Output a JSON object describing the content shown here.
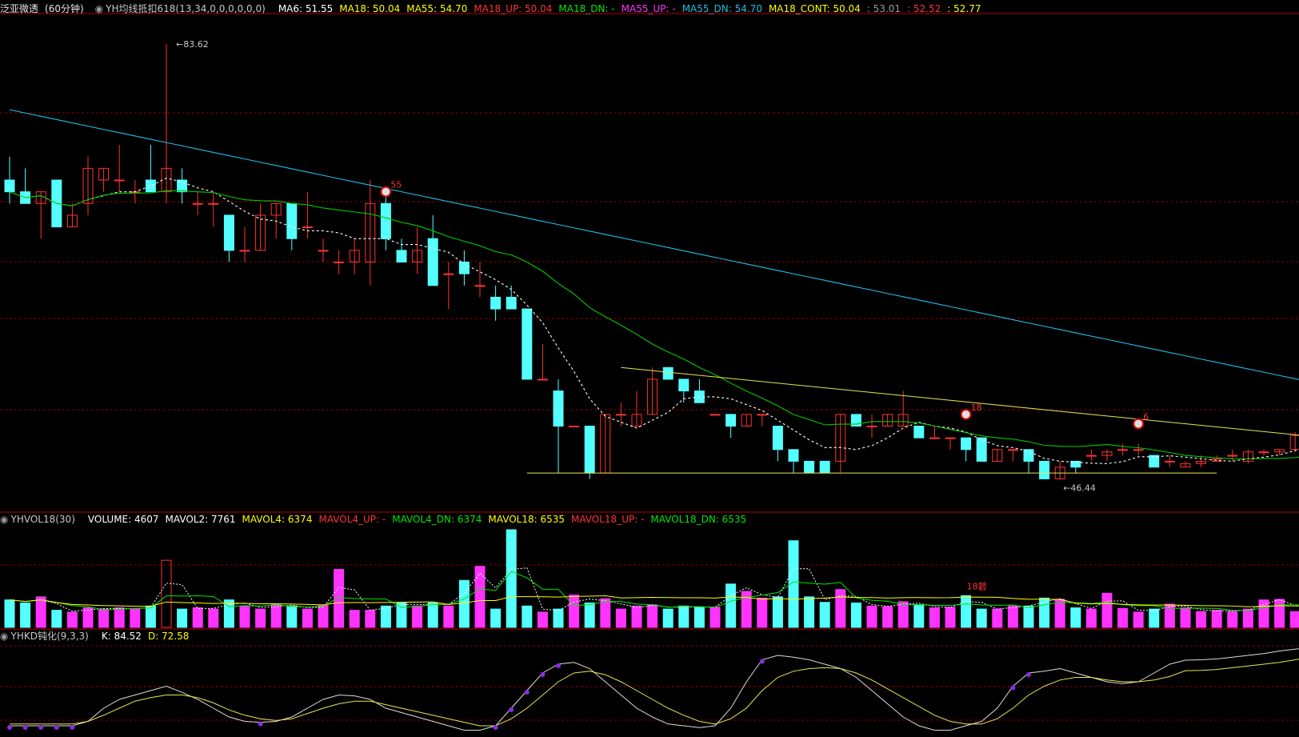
{
  "main_header": {
    "stock": "泛亚微透",
    "period": "(60分钟)",
    "indicator": "YH均线抵扣618(13,34,0,0,0,0,0,0)",
    "ma6": "MA6: 51.55",
    "ma18": "MA18: 50.04",
    "ma55": "MA55: 54.70",
    "ma18_up": "MA18_UP: 50.04",
    "ma18_dn": "MA18_DN: -",
    "ma55_up": "MA55_UP: -",
    "ma55_dn": "MA55_DN: 54.70",
    "ma18_cont": "MA18_CONT: 50.04",
    "v1": ": 53.01",
    "v2": ": 52.52",
    "v3": ": 52.77"
  },
  "vol_header": {
    "indicator": "YHVOL18(30)",
    "volume": "VOLUME: 4607",
    "mavol2": "MAVOL2: 7761",
    "mavol4": "MAVOL4: 6374",
    "mavol4_up": "MAVOL4_UP: -",
    "mavol4_dn": "MAVOL4_DN: 6374",
    "mavol18": "MAVOL18: 6535",
    "mavol18_up": "MAVOL18_UP: -",
    "mavol18_dn": "MAVOL18_DN: 6535"
  },
  "kd_header": {
    "indicator": "YHKD钝化(9,3,3)",
    "k": "K: 84.52",
    "d": "D: 72.58"
  },
  "annotations": {
    "high": "83.62",
    "low": "46.44",
    "mark1": "55",
    "mark2": "18",
    "mark3": "6",
    "vol_mark": "18碧"
  },
  "colors": {
    "up": "#ff3232",
    "down": "#54ffff",
    "ma6": "#ffffff",
    "ma18": "#00c800",
    "ma55": "#1ebde6",
    "trend": "#e6e650",
    "vol_up": "#ff32ff",
    "grid": "#8b0000"
  },
  "chart_data": {
    "type": "candlestick",
    "price_axis": [
      46.44,
      83.62
    ],
    "candles": [
      [
        72,
        74,
        70,
        71
      ],
      [
        71,
        73,
        70,
        70
      ],
      [
        70,
        71,
        67,
        71
      ],
      [
        72,
        72,
        68,
        68
      ],
      [
        68,
        70,
        68,
        69
      ],
      [
        70,
        74,
        69,
        73
      ],
      [
        72,
        73,
        71,
        73
      ],
      [
        72,
        75,
        71,
        72
      ],
      [
        71,
        72,
        70,
        71
      ],
      [
        72,
        75,
        71,
        71
      ],
      [
        71,
        83.62,
        70,
        73
      ],
      [
        72,
        73,
        70,
        71
      ],
      [
        70,
        71,
        69,
        70
      ],
      [
        70,
        71,
        68,
        70
      ],
      [
        69,
        69,
        65,
        66
      ],
      [
        66,
        68,
        65,
        66
      ],
      [
        66,
        70,
        66,
        69
      ],
      [
        69,
        70,
        67,
        70
      ],
      [
        70,
        70,
        66,
        67
      ],
      [
        68,
        71,
        67,
        68
      ],
      [
        66,
        67,
        65,
        66
      ],
      [
        65,
        66,
        64,
        65
      ],
      [
        65,
        67,
        64,
        66
      ],
      [
        65,
        72,
        63,
        70
      ],
      [
        70,
        71,
        66,
        67
      ],
      [
        66,
        67,
        65,
        65
      ],
      [
        65,
        68,
        64,
        66
      ],
      [
        67,
        69,
        63,
        63
      ],
      [
        64,
        65,
        61,
        64
      ],
      [
        65,
        66,
        63,
        64
      ],
      [
        63,
        65,
        62,
        63
      ],
      [
        62,
        63,
        60,
        61
      ],
      [
        62,
        63,
        61,
        61
      ],
      [
        61,
        61,
        55,
        55
      ],
      [
        55,
        58,
        55,
        55
      ],
      [
        54,
        55,
        47,
        51
      ],
      [
        51,
        51,
        51,
        51
      ],
      [
        51,
        51,
        46.5,
        47
      ],
      [
        47,
        52,
        47,
        52
      ],
      [
        52,
        53,
        51,
        52
      ],
      [
        51,
        54,
        51,
        52
      ],
      [
        52,
        56,
        52,
        55
      ],
      [
        56,
        56,
        55,
        55
      ],
      [
        55,
        55,
        53,
        54
      ],
      [
        54,
        55,
        53,
        53
      ],
      [
        52,
        52,
        52,
        52
      ],
      [
        52,
        52,
        50,
        51
      ],
      [
        51,
        52,
        51,
        52
      ],
      [
        52,
        52,
        51,
        52
      ],
      [
        51,
        51,
        48,
        49
      ],
      [
        49,
        49,
        47,
        48
      ],
      [
        48,
        48,
        47,
        47
      ],
      [
        48,
        48,
        47,
        47
      ],
      [
        48,
        52,
        47,
        52
      ],
      [
        52,
        52,
        51,
        51
      ],
      [
        51,
        52,
        50,
        51
      ],
      [
        51,
        52,
        51,
        52
      ],
      [
        51,
        54,
        51,
        52
      ],
      [
        51,
        51,
        50,
        50
      ],
      [
        50,
        51,
        50,
        50
      ],
      [
        50,
        50,
        49,
        50
      ],
      [
        50,
        50,
        48,
        49
      ],
      [
        50,
        50,
        48,
        48
      ],
      [
        48,
        49,
        48,
        49
      ],
      [
        49,
        49,
        48,
        49
      ],
      [
        49,
        49,
        47,
        48
      ],
      [
        48,
        48,
        46.5,
        46.5
      ],
      [
        46.5,
        48,
        46.44,
        47.5
      ],
      [
        48,
        48,
        47,
        47.5
      ],
      [
        48.5,
        49,
        48,
        48.5
      ],
      [
        48.5,
        49,
        48,
        48.8
      ],
      [
        49,
        49.5,
        48.5,
        49
      ],
      [
        49,
        49.5,
        48.5,
        49
      ],
      [
        48.5,
        48.5,
        47.5,
        47.5
      ],
      [
        48,
        48.5,
        47.5,
        48
      ],
      [
        47.5,
        48,
        47.5,
        47.8
      ],
      [
        47.8,
        48.5,
        47.5,
        48
      ],
      [
        48,
        48.5,
        48,
        48.2
      ],
      [
        48.5,
        49,
        48,
        48.5
      ],
      [
        48,
        49,
        47.8,
        48.8
      ],
      [
        48.8,
        49,
        48.5,
        48.8
      ],
      [
        48.8,
        49,
        48.5,
        49
      ],
      [
        49,
        50.5,
        48.8,
        50.2
      ],
      [
        50.5,
        51.5,
        50.2,
        51.3
      ],
      [
        50.5,
        52.52,
        50.5,
        52.52
      ]
    ],
    "volume_axis": [
      0,
      16000
    ],
    "volume": [
      4500,
      4000,
      5000,
      2800,
      2500,
      3200,
      3000,
      3200,
      3000,
      3500,
      11000,
      3000,
      3200,
      3000,
      4500,
      3500,
      3000,
      3800,
      3500,
      3000,
      3600,
      9500,
      2800,
      2800,
      3500,
      4000,
      3500,
      4000,
      3500,
      7700,
      10000,
      3000,
      16000,
      3500,
      2500,
      3000,
      5300,
      4000,
      4700,
      3000,
      3500,
      3700,
      3000,
      3500,
      3300,
      3300,
      7100,
      5900,
      4800,
      5000,
      14200,
      5000,
      4100,
      6200,
      4000,
      3500,
      3400,
      4200,
      3700,
      3200,
      3300,
      5200,
      3000,
      3000,
      3500,
      3500,
      4800,
      4600,
      3200,
      3000,
      5600,
      3100,
      2500,
      3000,
      3800,
      3200,
      2600,
      2800,
      2600,
      3000,
      4500,
      4600,
      2600,
      3500,
      2800
    ],
    "k_values": [
      10,
      10,
      10,
      10,
      10,
      15,
      30,
      40,
      45,
      50,
      55,
      48,
      40,
      30,
      20,
      15,
      14,
      15,
      20,
      30,
      40,
      45,
      44,
      40,
      30,
      25,
      20,
      15,
      10,
      5,
      5,
      10,
      30,
      50,
      70,
      80,
      82,
      75,
      60,
      45,
      30,
      20,
      12,
      10,
      8,
      10,
      30,
      60,
      85,
      90,
      88,
      85,
      80,
      75,
      65,
      50,
      35,
      20,
      10,
      5,
      5,
      10,
      15,
      30,
      55,
      70,
      72,
      75,
      70,
      65,
      60,
      58,
      60,
      70,
      80,
      84.52,
      85,
      86,
      88,
      90,
      92,
      95,
      97,
      99,
      100
    ],
    "d_values": [
      12,
      12,
      12,
      12,
      12,
      15,
      22,
      30,
      38,
      42,
      45,
      45,
      42,
      36,
      28,
      22,
      18,
      16,
      18,
      24,
      30,
      35,
      38,
      38,
      34,
      30,
      26,
      22,
      18,
      14,
      10,
      10,
      18,
      30,
      45,
      60,
      70,
      72,
      68,
      60,
      50,
      40,
      30,
      22,
      15,
      12,
      18,
      30,
      50,
      65,
      72,
      75,
      76,
      75,
      70,
      62,
      52,
      42,
      32,
      22,
      15,
      12,
      12,
      18,
      30,
      45,
      55,
      62,
      65,
      65,
      62,
      60,
      60,
      62,
      66,
      72.58,
      73,
      74,
      76,
      78,
      80,
      82,
      85,
      88,
      90
    ]
  }
}
